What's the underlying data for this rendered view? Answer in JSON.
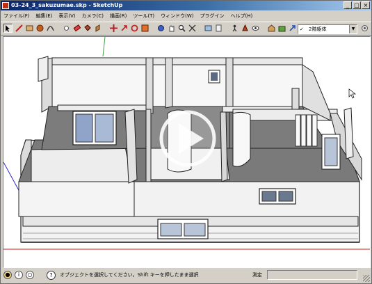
{
  "window": {
    "title": "03-24_3_sakuzumae.skp - SketchUp",
    "minimize": "_",
    "maximize": "□",
    "close": "×"
  },
  "menu": {
    "items": [
      "ファイル(F)",
      "編集(E)",
      "表示(V)",
      "カメラ(C)",
      "描画(R)",
      "ツール(T)",
      "ウィンドウ(W)",
      "プラグイン",
      "ヘルプ(H)"
    ]
  },
  "toolbar": {
    "tools": [
      "select-tool",
      "line-tool",
      "rectangle-tool",
      "circle-tool",
      "arc-tool",
      "component-tool",
      "eraser-tool",
      "paint-bucket-tool",
      "push-pull-tool",
      "follow-me-tool",
      "move-tool",
      "rotate-tool",
      "scale-tool",
      "offset-tool",
      "orbit-tool",
      "pan-tool",
      "zoom-tool",
      "zoom-extents-tool",
      "previous-view-tool",
      "section-tool",
      "walk-tool",
      "position-camera-tool",
      "look-around-tool",
      "warehouse-tool",
      "components-tool",
      "share-model-tool"
    ],
    "scene_select": {
      "check": "✓",
      "value": "2階躯体",
      "arrow": "▼"
    },
    "end_icon": "layers-icon"
  },
  "viewport": {
    "play_symbol": "▶"
  },
  "status": {
    "message": "オブジェクトを選択してください。Shift キーを押したまま選択",
    "measurement_label": "測定",
    "help": "?"
  },
  "colors": {
    "title_start": "#0a246a",
    "title_end": "#a6caf0",
    "red_axis": "#c81e1e",
    "green_axis": "#3ca03c",
    "blue_axis": "#2828c8",
    "floor_gray": "#7a7a7a",
    "wall_fill": "#ececec",
    "glass_blue": "#8fa4c8"
  }
}
